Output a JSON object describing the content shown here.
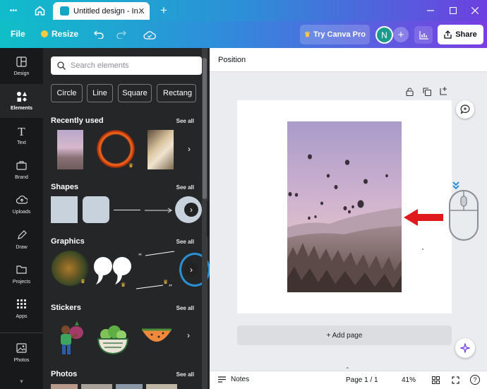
{
  "titlebar": {
    "tab_title": "Untitled design - In...",
    "new_tab": "+",
    "more": "•••"
  },
  "toolbar": {
    "file": "File",
    "resize": "Resize",
    "try_pro": "Try Canva Pro",
    "avatar_initial": "N",
    "share": "Share"
  },
  "rail": {
    "items": [
      {
        "label": "Design",
        "icon": "design-icon"
      },
      {
        "label": "Elements",
        "icon": "elements-icon"
      },
      {
        "label": "Text",
        "icon": "text-icon"
      },
      {
        "label": "Brand",
        "icon": "brand-icon"
      },
      {
        "label": "Uploads",
        "icon": "uploads-icon"
      },
      {
        "label": "Draw",
        "icon": "draw-icon"
      },
      {
        "label": "Projects",
        "icon": "projects-icon"
      },
      {
        "label": "Apps",
        "icon": "apps-icon"
      },
      {
        "label": "Photos",
        "icon": "photos-icon"
      }
    ]
  },
  "panel": {
    "search_placeholder": "Search elements",
    "chips": [
      "Circle",
      "Line",
      "Square",
      "Rectang"
    ],
    "sections": [
      {
        "title": "Recently used",
        "see_all": "See all"
      },
      {
        "title": "Shapes",
        "see_all": "See all"
      },
      {
        "title": "Graphics",
        "see_all": "See all"
      },
      {
        "title": "Stickers",
        "see_all": "See all"
      },
      {
        "title": "Photos",
        "see_all": "See all"
      }
    ]
  },
  "canvas": {
    "position_label": "Position",
    "add_page": "+ Add page"
  },
  "statusbar": {
    "notes": "Notes",
    "page": "Page 1 / 1",
    "zoom": "41%"
  },
  "colors": {
    "brand_accent": "#7d2ae8",
    "avatar_bg": "#1a9b8c",
    "annotation_arrow": "#e0191d"
  }
}
